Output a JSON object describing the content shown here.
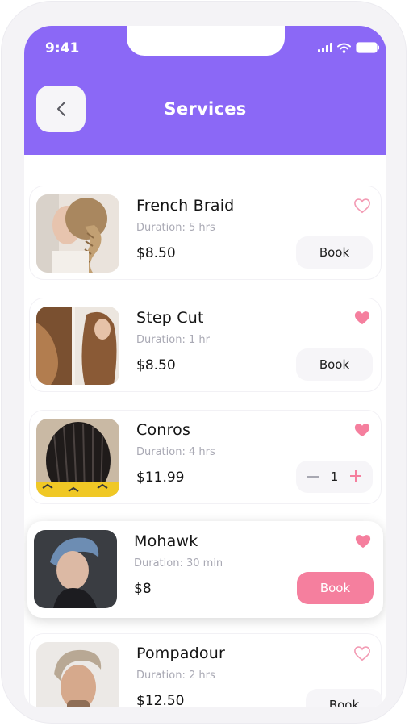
{
  "status_bar": {
    "time": "9:41"
  },
  "header": {
    "title": "Services",
    "back_icon": "chevron-left-icon"
  },
  "colors": {
    "brand_purple": "#8b68f6",
    "accent_pink": "#f57f9e",
    "heart_outline": "#f39bb4"
  },
  "services": [
    {
      "name": "French Braid",
      "duration": "Duration: 5 hrs",
      "price": "$8.50",
      "favorite": false,
      "action": "Book"
    },
    {
      "name": "Step Cut",
      "duration": "Duration: 1 hr",
      "price": "$8.50",
      "favorite": true,
      "action": "Book"
    },
    {
      "name": "Conros",
      "duration": "Duration: 4 hrs",
      "price": "$11.99",
      "favorite": true,
      "quantity": "1"
    },
    {
      "name": "Mohawk",
      "duration": "Duration: 30 min",
      "price": "$8",
      "favorite": true,
      "action": "Book"
    },
    {
      "name": "Pompadour",
      "duration": "Duration: 2 hrs",
      "price": "$12.50",
      "favorite": false,
      "action": "Book"
    }
  ]
}
